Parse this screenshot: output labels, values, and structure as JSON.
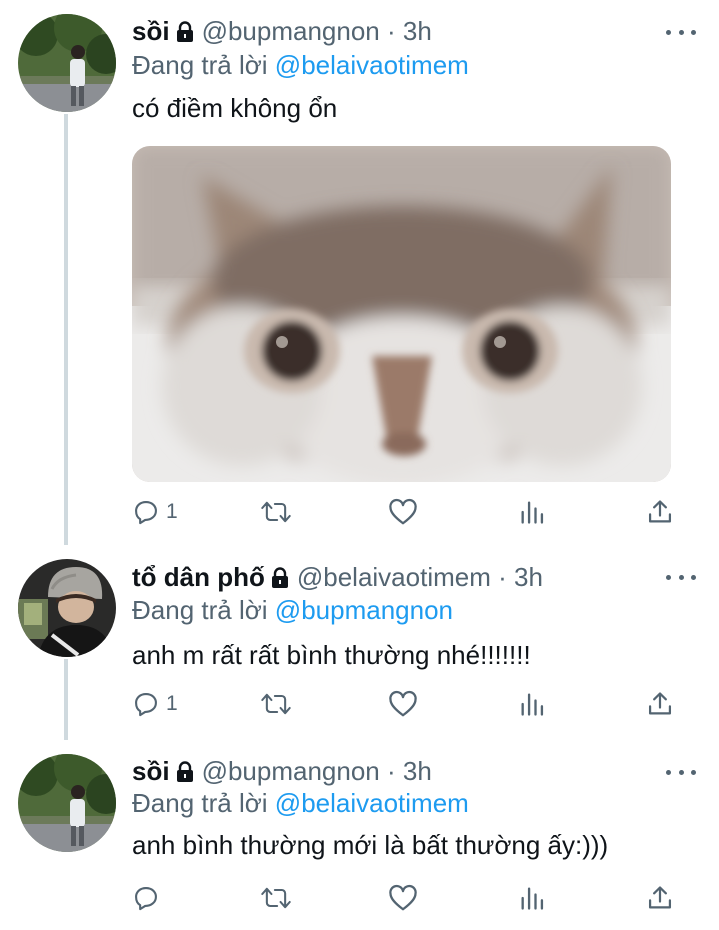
{
  "tweets": [
    {
      "name": "sồi",
      "handle": "@bupmangnon",
      "dot": "·",
      "time": "3h",
      "replying_prefix": "Đang trả lời",
      "replying_to": "@belaivaotimem",
      "text": "có điềm không ổn",
      "reply_count": "1",
      "has_media": true
    },
    {
      "name": "tổ dân phố",
      "handle": "@belaivaotimem",
      "dot": "·",
      "time": "3h",
      "replying_prefix": "Đang trả lời",
      "replying_to": "@bupmangnon",
      "text": "anh m rất rất bình thường nhé!!!!!!!",
      "reply_count": "1"
    },
    {
      "name": "sồi",
      "handle": "@bupmangnon",
      "dot": "·",
      "time": "3h",
      "replying_prefix": "Đang trả lời",
      "replying_to": "@belaivaotimem",
      "text": "anh bình thường mới là bất thường ấy:)))",
      "reply_count": ""
    }
  ],
  "icons": {
    "lock": "lock-icon",
    "more": "more-icon",
    "reply": "reply-icon",
    "retweet": "retweet-icon",
    "like": "heart-icon",
    "analytics": "analytics-icon",
    "share": "share-icon"
  },
  "colors": {
    "link": "#1d9bf0",
    "muted": "#536471",
    "text": "#0f1419",
    "thread_line": "#cfd9de"
  }
}
